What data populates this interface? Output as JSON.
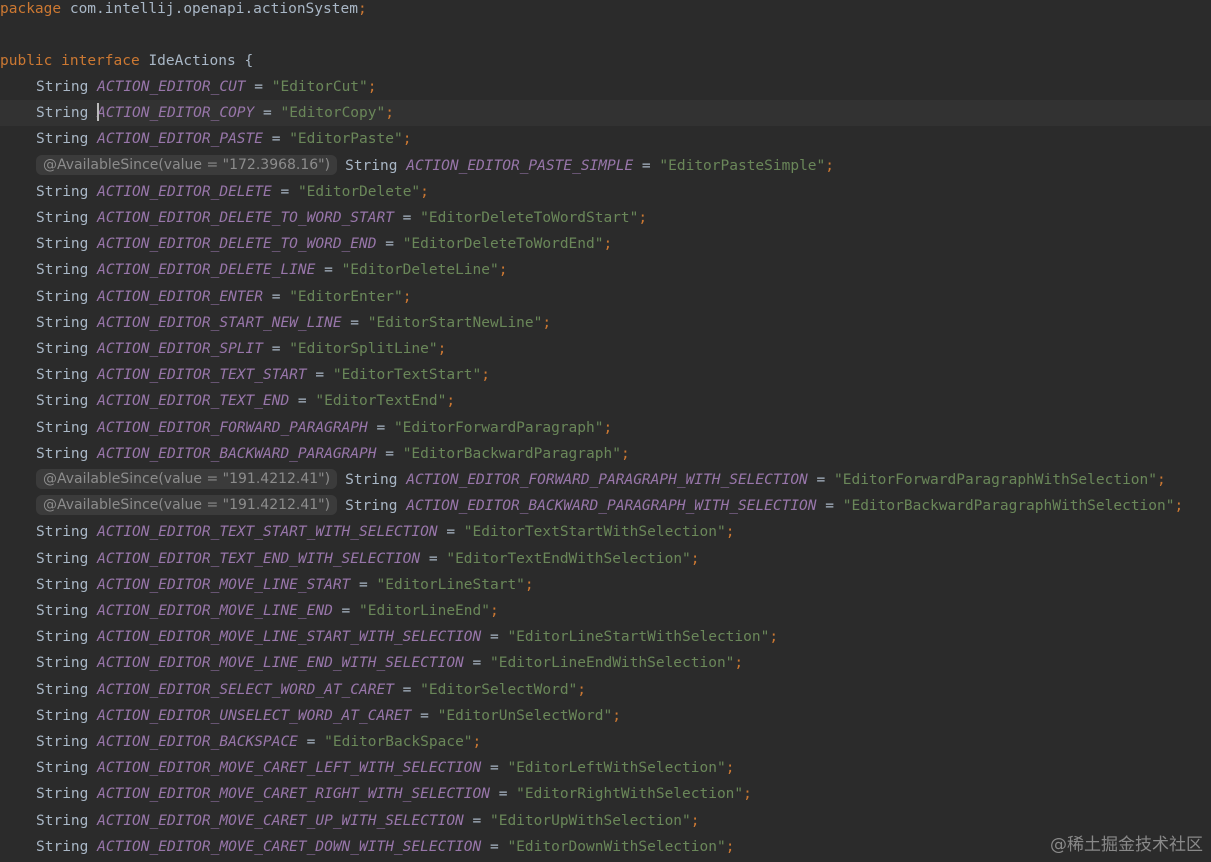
{
  "editor": {
    "package_line": {
      "keyword": "package",
      "name": "com.intellij.openapi.actionSystem",
      "semicolon": ";"
    },
    "interface_line": {
      "kw_public": "public",
      "kw_interface": "interface",
      "name": "IdeActions",
      "brace": "{"
    },
    "type_name": "String",
    "caret_line_index": 1,
    "fields": [
      {
        "name": "ACTION_EDITOR_CUT",
        "value": "\"EditorCut\""
      },
      {
        "name": "ACTION_EDITOR_COPY",
        "value": "\"EditorCopy\""
      },
      {
        "name": "ACTION_EDITOR_PASTE",
        "value": "\"EditorPaste\""
      },
      {
        "hint_prefix": "@AvailableSince(value = ",
        "hint_value": "\"172.3968.16\"",
        "hint_suffix": ")",
        "name": "ACTION_EDITOR_PASTE_SIMPLE",
        "value": "\"EditorPasteSimple\""
      },
      {
        "name": "ACTION_EDITOR_DELETE",
        "value": "\"EditorDelete\""
      },
      {
        "name": "ACTION_EDITOR_DELETE_TO_WORD_START",
        "value": "\"EditorDeleteToWordStart\""
      },
      {
        "name": "ACTION_EDITOR_DELETE_TO_WORD_END",
        "value": "\"EditorDeleteToWordEnd\""
      },
      {
        "name": "ACTION_EDITOR_DELETE_LINE",
        "value": "\"EditorDeleteLine\""
      },
      {
        "name": "ACTION_EDITOR_ENTER",
        "value": "\"EditorEnter\""
      },
      {
        "name": "ACTION_EDITOR_START_NEW_LINE",
        "value": "\"EditorStartNewLine\""
      },
      {
        "name": "ACTION_EDITOR_SPLIT",
        "value": "\"EditorSplitLine\""
      },
      {
        "name": "ACTION_EDITOR_TEXT_START",
        "value": "\"EditorTextStart\""
      },
      {
        "name": "ACTION_EDITOR_TEXT_END",
        "value": "\"EditorTextEnd\""
      },
      {
        "name": "ACTION_EDITOR_FORWARD_PARAGRAPH",
        "value": "\"EditorForwardParagraph\""
      },
      {
        "name": "ACTION_EDITOR_BACKWARD_PARAGRAPH",
        "value": "\"EditorBackwardParagraph\""
      },
      {
        "hint_prefix": "@AvailableSince(value = ",
        "hint_value": "\"191.4212.41\"",
        "hint_suffix": ")",
        "name": "ACTION_EDITOR_FORWARD_PARAGRAPH_WITH_SELECTION",
        "value": "\"EditorForwardParagraphWithSelection\""
      },
      {
        "hint_prefix": "@AvailableSince(value = ",
        "hint_value": "\"191.4212.41\"",
        "hint_suffix": ")",
        "name": "ACTION_EDITOR_BACKWARD_PARAGRAPH_WITH_SELECTION",
        "value": "\"EditorBackwardParagraphWithSelection\""
      },
      {
        "name": "ACTION_EDITOR_TEXT_START_WITH_SELECTION",
        "value": "\"EditorTextStartWithSelection\""
      },
      {
        "name": "ACTION_EDITOR_TEXT_END_WITH_SELECTION",
        "value": "\"EditorTextEndWithSelection\""
      },
      {
        "name": "ACTION_EDITOR_MOVE_LINE_START",
        "value": "\"EditorLineStart\""
      },
      {
        "name": "ACTION_EDITOR_MOVE_LINE_END",
        "value": "\"EditorLineEnd\""
      },
      {
        "name": "ACTION_EDITOR_MOVE_LINE_START_WITH_SELECTION",
        "value": "\"EditorLineStartWithSelection\""
      },
      {
        "name": "ACTION_EDITOR_MOVE_LINE_END_WITH_SELECTION",
        "value": "\"EditorLineEndWithSelection\""
      },
      {
        "name": "ACTION_EDITOR_SELECT_WORD_AT_CARET",
        "value": "\"EditorSelectWord\""
      },
      {
        "name": "ACTION_EDITOR_UNSELECT_WORD_AT_CARET",
        "value": "\"EditorUnSelectWord\""
      },
      {
        "name": "ACTION_EDITOR_BACKSPACE",
        "value": "\"EditorBackSpace\""
      },
      {
        "name": "ACTION_EDITOR_MOVE_CARET_LEFT_WITH_SELECTION",
        "value": "\"EditorLeftWithSelection\""
      },
      {
        "name": "ACTION_EDITOR_MOVE_CARET_RIGHT_WITH_SELECTION",
        "value": "\"EditorRightWithSelection\""
      },
      {
        "name": "ACTION_EDITOR_MOVE_CARET_UP_WITH_SELECTION",
        "value": "\"EditorUpWithSelection\""
      },
      {
        "name": "ACTION_EDITOR_MOVE_CARET_DOWN_WITH_SELECTION",
        "value": "\"EditorDownWithSelection\""
      }
    ]
  },
  "watermark": "@稀土掘金技术社区",
  "colors": {
    "background": "#2b2b2b",
    "keyword": "#cc7832",
    "constant": "#9876aa",
    "string": "#6a8759",
    "text": "#a9b7c6",
    "hint_background": "#3b3b3b",
    "hint_text": "#8c8c8c",
    "current_line": "#323232"
  }
}
